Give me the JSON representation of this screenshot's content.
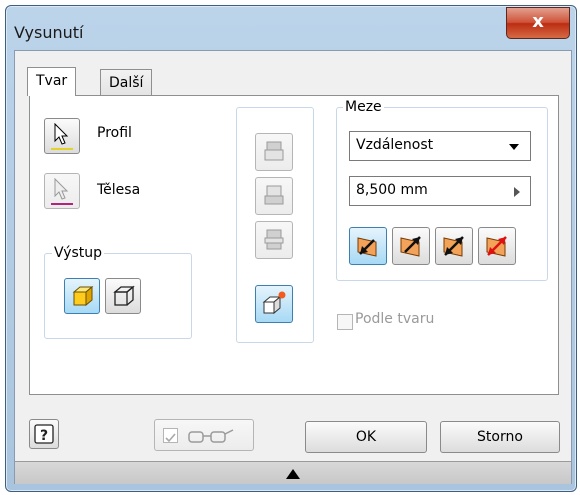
{
  "window": {
    "title": "Vysunutí",
    "close_label": "x"
  },
  "tabs": [
    {
      "label": "Tvar"
    },
    {
      "label": "Další"
    }
  ],
  "left": {
    "profile_label": "Profil",
    "bodies_label": "Tělesa"
  },
  "output_group": {
    "title": "Výstup"
  },
  "extents_group": {
    "title": "Meze",
    "extent_type": "Vzdálenost",
    "distance_value": "8,500 mm"
  },
  "match_shape_label": "Podle tvaru",
  "buttons": {
    "ok_label": "OK",
    "cancel_label": "Storno"
  },
  "colors": {
    "accent": "#3c7fb1",
    "title_bar": "#b3cce6",
    "close": "#c8442b"
  }
}
